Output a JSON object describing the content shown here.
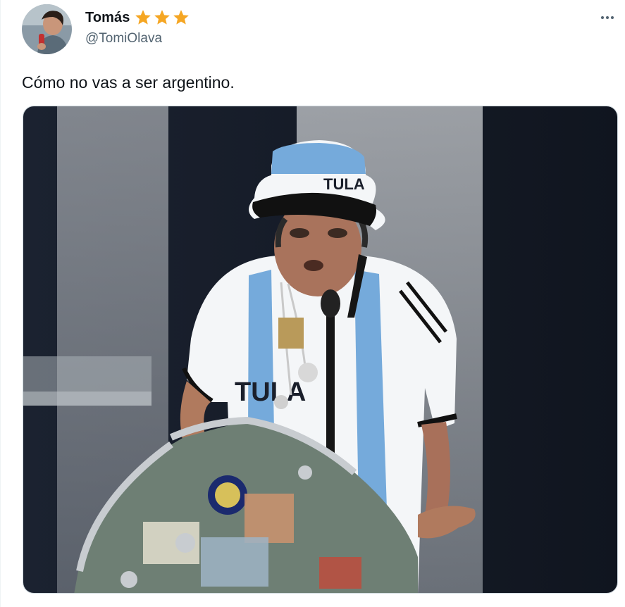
{
  "tweet": {
    "author": {
      "display_name": "Tomás",
      "handle": "@TomiOlava",
      "avatar_icon": "profile-photo",
      "badges": [
        "star-icon",
        "star-icon",
        "star-icon"
      ],
      "badge_color": "#f5a623"
    },
    "text": "Cómo no vas a ser argentino.",
    "media": {
      "type": "photo",
      "hat_text": "TULA",
      "shirt_text": "TULA"
    },
    "more_icon": "more-options-icon"
  },
  "colors": {
    "text_primary": "#0f1419",
    "text_secondary": "#536471",
    "border": "#cfd9de",
    "argentina_blue": "#75aadb"
  }
}
